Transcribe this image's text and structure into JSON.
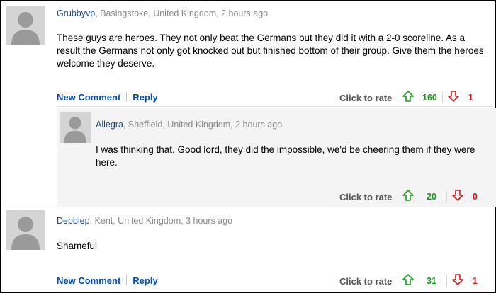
{
  "comments": [
    {
      "username": "Grubbyvp",
      "location": ", Basingstoke, United Kingdom, 2 hours ago",
      "text": "These guys are heroes. They not only beat the Germans but they did it with a 2-0 scoreline. As a result the Germans not only got knocked out but finished bottom of their group. Give them the heroes welcome they deserve.",
      "new_comment_label": "New Comment",
      "reply_label": "Reply",
      "rate_label": "Click to rate",
      "upvotes": "160",
      "downvotes": "1"
    },
    {
      "username": "Allegra",
      "location": ", Sheffield, United Kingdom, 2 hours ago",
      "text": "I was thinking that. Good lord, they did the impossible, we'd be cheering them if they were here.",
      "rate_label": "Click to rate",
      "upvotes": "20",
      "downvotes": "0"
    },
    {
      "username": "Debbiep",
      "location": ", Kent, United Kingdom, 3 hours ago",
      "text": "Shameful",
      "new_comment_label": "New Comment",
      "reply_label": "Reply",
      "rate_label": "Click to rate",
      "upvotes": "31",
      "downvotes": "1"
    }
  ],
  "colors": {
    "username": "#1a4a8a",
    "action_link": "#004db3",
    "upvote": "#1a9a1a",
    "downvote": "#cc1a1a",
    "reply_bg": "#f4f4f4"
  },
  "icons": {
    "avatar": "avatar-placeholder-icon",
    "upvote": "thumb-up-arrow-icon",
    "downvote": "thumb-down-arrow-icon"
  }
}
